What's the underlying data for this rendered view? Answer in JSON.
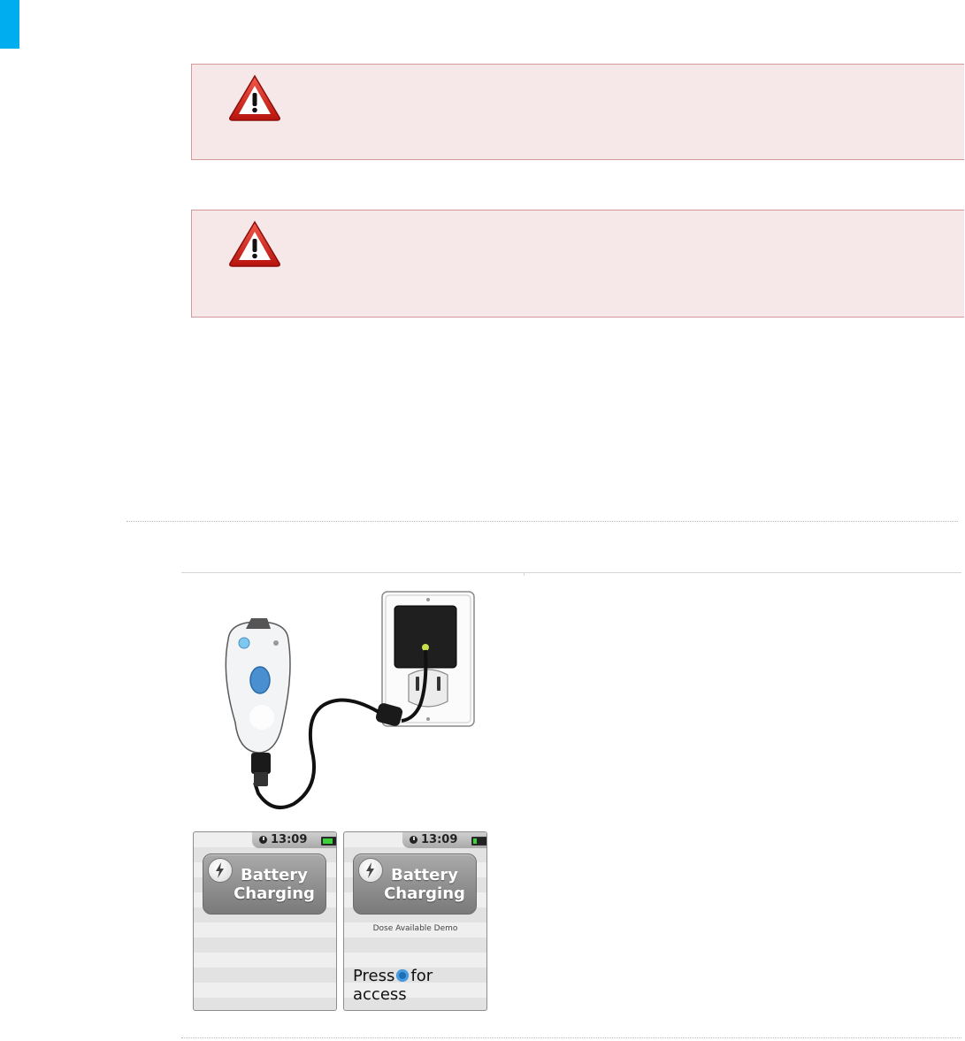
{
  "icons": {
    "warning": "warning-triangle-icon",
    "clock": "clock-icon",
    "battery": "battery-icon",
    "bolt": "lightning-bolt-icon",
    "button": "round-button-icon"
  },
  "colors": {
    "accent": "#00aeef",
    "warning_background": "#f6e8e8",
    "warning_border": "#d49a9a",
    "warning_icon_red": "#d8261e"
  },
  "screens": [
    {
      "time": "13:09",
      "battery_level": 0.7,
      "title_line1": "Battery",
      "title_line2": "Charging",
      "subtext": "",
      "press_before": "",
      "press_after": "",
      "press_line2": ""
    },
    {
      "time": "13:09",
      "battery_level": 0.25,
      "title_line1": "Battery",
      "title_line2": "Charging",
      "subtext": "Dose Available Demo",
      "press_before": "Press",
      "press_after": "for",
      "press_line2": "access"
    }
  ]
}
